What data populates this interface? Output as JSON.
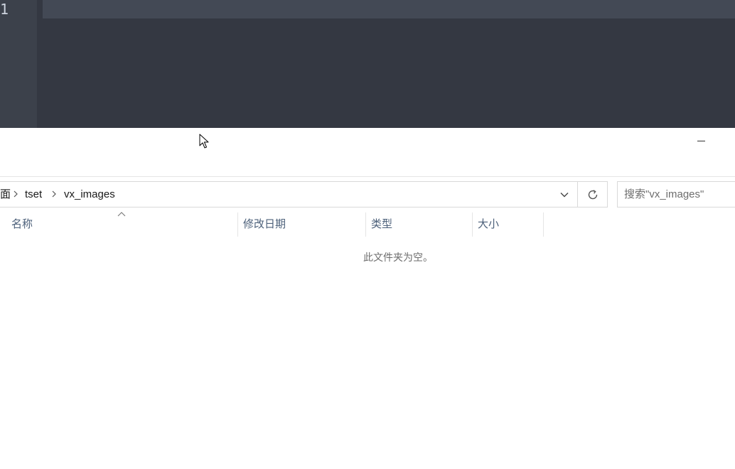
{
  "editor": {
    "line_number": "1"
  },
  "explorer": {
    "breadcrumb": {
      "partial_segment": "面",
      "segments": [
        "tset",
        "vx_images"
      ]
    },
    "search": {
      "placeholder": "搜索\"vx_images\""
    },
    "columns": {
      "name": "名称",
      "modified": "修改日期",
      "type": "类型",
      "size": "大小"
    },
    "empty_message": "此文件夹为空。"
  },
  "icons": {
    "minimize": "minimize-icon",
    "chevron": "chevron-right-icon",
    "dropdown": "chevron-down-icon",
    "refresh": "refresh-icon",
    "sort": "sort-ascending-icon",
    "cursor": "mouse-cursor-icon"
  }
}
